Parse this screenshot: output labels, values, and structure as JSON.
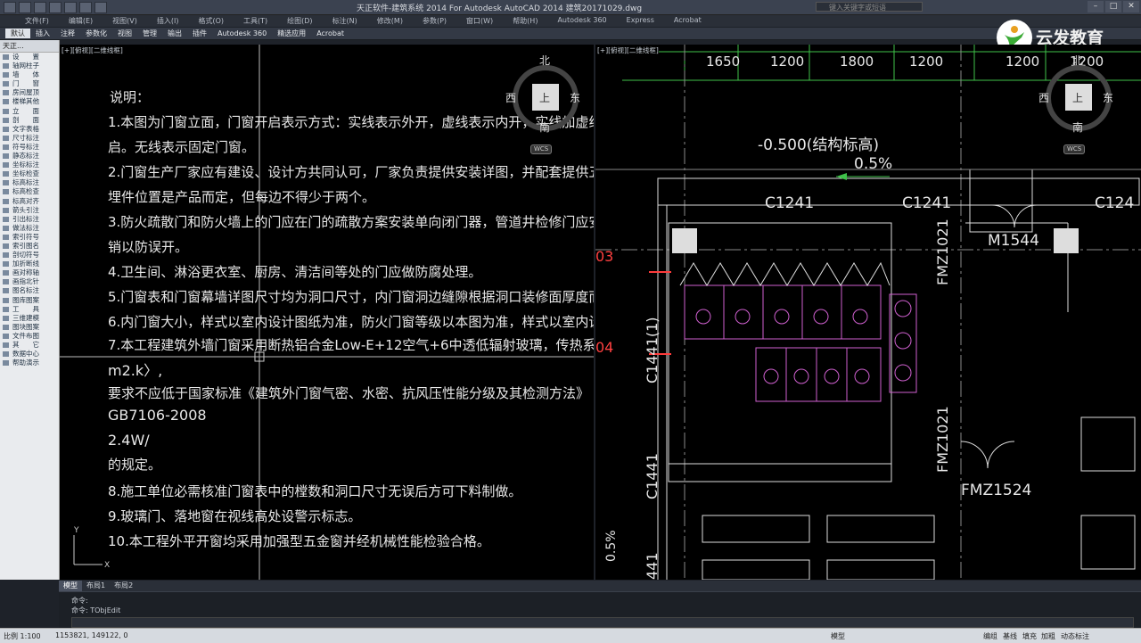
{
  "titlebar": {
    "title": "天正软件-建筑系统 2014   For Autodesk AutoCAD 2014   建筑20171029.dwg",
    "search_placeholder": "键入关键字或短语"
  },
  "menubar": {
    "items": [
      "文件(F)",
      "编辑(E)",
      "视图(V)",
      "插入(I)",
      "格式(O)",
      "工具(T)",
      "绘图(D)",
      "标注(N)",
      "修改(M)",
      "参数(P)",
      "窗口(W)",
      "帮助(H)",
      "Autodesk 360",
      "Express",
      "Acrobat"
    ]
  },
  "ribbon": {
    "tabs": [
      "默认",
      "插入",
      "注释",
      "参数化",
      "视图",
      "管理",
      "输出",
      "插件",
      "Autodesk 360",
      "精选应用",
      "Acrobat"
    ]
  },
  "logo": {
    "text": "云发教育"
  },
  "palette": {
    "header": "天正...",
    "items": [
      "设　　置",
      "轴网柱子",
      "墙　　体",
      "门　　窗",
      "房间屋顶",
      "楼梯其他",
      "立　　面",
      "剖　　面",
      "文字表格",
      "尺寸标注",
      "符号标注",
      "静态标注",
      "坐标标注",
      "坐标检查",
      "标高标注",
      "标高检查",
      "标高对齐",
      "箭头引注",
      "引出标注",
      "做法标注",
      "索引符号",
      "索引图名",
      "剖切符号",
      "加折断线",
      "画对称轴",
      "画指北针",
      "图名标注",
      "图库图案",
      "工　　具",
      "三维建模",
      "图块图案",
      "文件布图",
      "其　　它",
      "数据中心",
      "帮助演示"
    ]
  },
  "viewport_left": {
    "label": "[+][俯视][二维线框]",
    "compass": {
      "n": "北",
      "s": "南",
      "e": "东",
      "w": "西",
      "center": "上"
    },
    "ucs": "WCS",
    "notes": [
      "说明：",
      "1.本图为门窗立面，门窗开启表示方式：实线表示外开，虚线表示内开，实线加虚线表示双向开",
      "启。无线表示固定门窗。",
      "2.门窗生产厂家应有建设、设计方共同认可，厂家负责提供安装详图，并配套提供五金配件。",
      "埋件位置是产品而定，但每边不得少于两个。",
      "3.防火疏散门和防火墙上的门应在门的疏散方案安装单向闭门器，管道井检修门应安装暗藏式",
      "销以防误开。",
      "4.卫生间、淋浴更衣室、厨房、清洁间等处的门应做防腐处理。",
      "5.门窗表和门窗幕墙详图尺寸均为洞口尺寸，内门窗洞边缝隙根据洞口装修面厚度而定。",
      "6.内门窗大小，样式以室内设计图纸为准，防火门窗等级以本图为准，样式以室内设计为准。",
      "7.本工程建筑外墙门窗采用断热铝合金Low-E+12空气+6中透低辐射玻璃，传热系数〈",
      "m2.k〉,",
      "要求不应低于国家标准《建筑外门窗气密、水密、抗风压性能分级及其检测方法》",
      "GB7106-2008",
      "2.4W/",
      "的规定。",
      "8.施工单位必需核准门窗表中的樘数和洞口尺寸无误后方可下料制做。",
      "9.玻璃门、落地窗在视线高处设警示标志。",
      "10.本工程外平开窗均采用加强型五金窗并经机械性能检验合格。"
    ]
  },
  "viewport_right": {
    "label": "[+][俯视][二维线框]",
    "compass": {
      "n": "北",
      "s": "南",
      "e": "东",
      "w": "西",
      "center": "上"
    },
    "ucs": "WCS",
    "dims": [
      "1650",
      "1200",
      "1800",
      "1200",
      "1200",
      "1200"
    ],
    "texts": {
      "elev": "-0.500(结构标高)",
      "slope": "0.5%",
      "c1": "C1241",
      "c2": "C1241",
      "c3": "C124",
      "m": "M1544",
      "fmz1": "FMZ1021",
      "fmz2": "FMZ1021",
      "fmz3": "FMZ1524",
      "c4": "C1441(1)",
      "c5": "C1441",
      "n03": "03",
      "n04": "04",
      "slope2": "0.5%",
      "c6": "441"
    }
  },
  "layout_tabs": [
    "模型",
    "布局1",
    "布局2"
  ],
  "command": {
    "line1": "命令:",
    "line2": "命令: TObjEdit",
    "input_placeholder": ""
  },
  "status": {
    "scale": "比例 1:100",
    "coords": "1153821, 149122, 0",
    "right_items": [
      "模型",
      "编组",
      "基线",
      "填充",
      "加粗",
      "动态标注"
    ]
  }
}
